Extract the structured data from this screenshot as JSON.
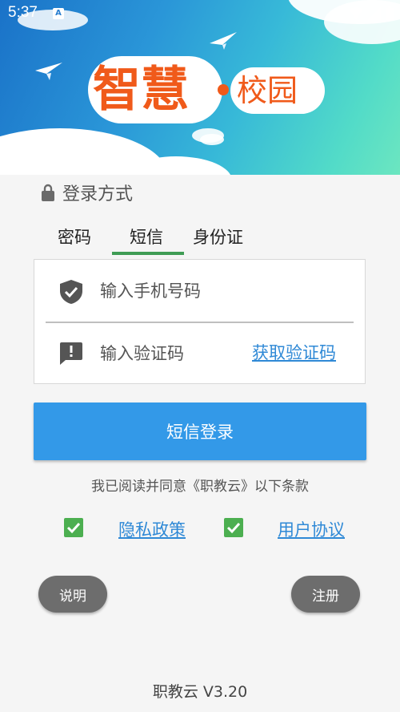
{
  "status_bar": {
    "time": "5:37",
    "notification_icon": "A"
  },
  "header": {
    "logo_main": "智慧",
    "logo_sub": "校园"
  },
  "login_method": {
    "label": "登录方式",
    "icon": "lock-icon"
  },
  "tabs": [
    {
      "label": "密码"
    },
    {
      "label": "短信",
      "selected": true
    },
    {
      "label": "身份证"
    }
  ],
  "form": {
    "phone_placeholder": "输入手机号码",
    "code_placeholder": "输入验证码",
    "get_code_label": "获取验证码"
  },
  "submit_label": "短信登录",
  "agreement": {
    "text": "我已阅读并同意《职教云》以下条款",
    "privacy_label": "隐私政策",
    "user_agreement_label": "用户协议",
    "privacy_checked": true,
    "user_agreement_checked": true
  },
  "buttons": {
    "help_label": "说明",
    "register_label": "注册"
  },
  "version": "职教云 V3.20",
  "colors": {
    "accent_blue": "#3399e8",
    "link_blue": "#2f89d6",
    "tab_underline": "#3f9c55",
    "checkbox_green": "#4caf50",
    "logo_orange": "#f05a1a",
    "pill_gray": "#6d6d6d"
  }
}
